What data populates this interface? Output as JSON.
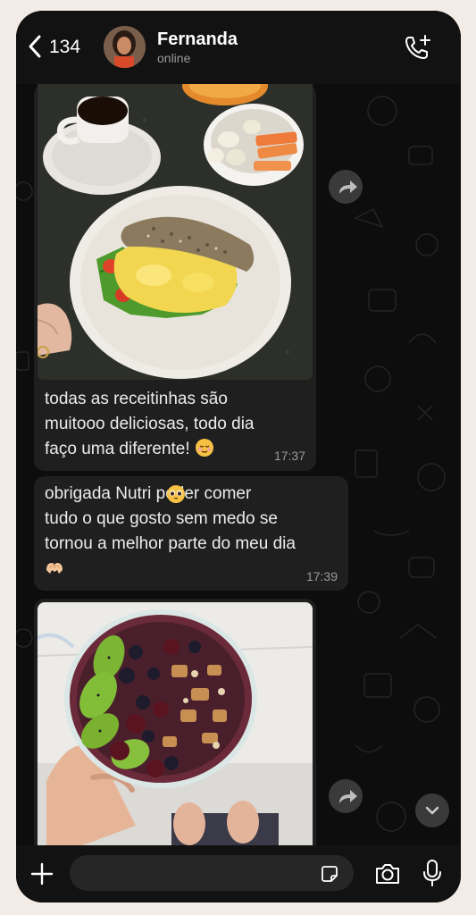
{
  "header": {
    "back_count": "134",
    "contact_name": "Fernanda",
    "contact_status": "online",
    "icons": [
      "chevron-left-icon",
      "phone-plus-icon"
    ]
  },
  "messages": [
    {
      "type": "image-with-caption",
      "image": "breakfast-sandwich-coffee-fruit",
      "text": "todas as receitinhas são\nmuitooo deliciosas, todo dia\nfaço uma diferente! ",
      "emoji": "relieved-face",
      "time": "17:37"
    },
    {
      "type": "text",
      "text": "obrigada Nutri  poder comer\ntudo o que gosto sem  medo se\ntornou a melhor parte do meu dia\n",
      "emoji": [
        "pleading-face",
        "heart-hands"
      ],
      "time": "17:39"
    },
    {
      "type": "image",
      "image": "acai-bowl-kiwi-berries-granola"
    }
  ],
  "composer": {
    "placeholder": "",
    "icons": [
      "plus-icon",
      "sticker-icon",
      "camera-icon",
      "mic-icon"
    ]
  },
  "colors": {
    "chat_bg": "#0d0d0d",
    "bubble": "#1f1f1f",
    "header": "#121212",
    "page_bg": "#f3ece6"
  }
}
